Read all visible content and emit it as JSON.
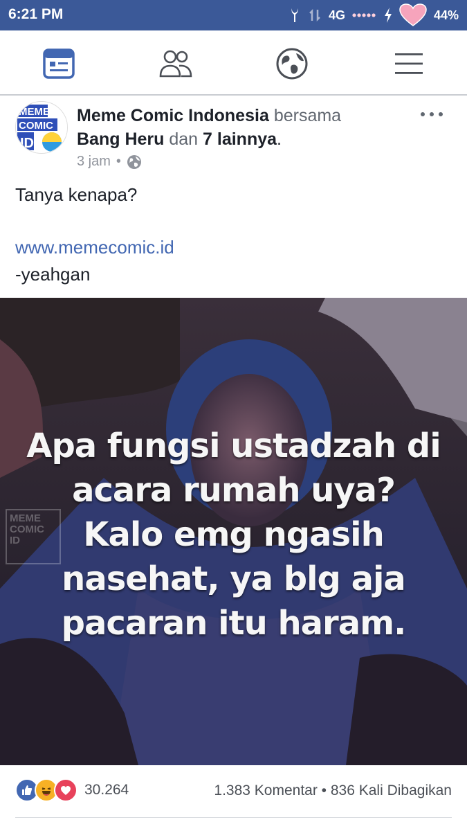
{
  "status_bar": {
    "time": "6:21 PM",
    "network": "4G",
    "battery": "44%"
  },
  "nav": {
    "tabs": [
      {
        "name": "news-feed-icon",
        "active": true
      },
      {
        "name": "friends-icon",
        "active": false
      },
      {
        "name": "notifications-globe-icon",
        "active": false
      },
      {
        "name": "menu-icon",
        "active": false
      }
    ],
    "accent_color": "#4267b2"
  },
  "post": {
    "page_name": "Meme Comic Indonesia",
    "with_word": "bersama",
    "tagged_person": "Bang Heru",
    "and_word": "dan",
    "others": "7 lainnya",
    "period": ".",
    "time": "3 jam",
    "separator": "•",
    "privacy_icon": "globe-icon",
    "avatar_text": [
      "MEME",
      "COMIC",
      "ID"
    ],
    "text": "Tanya kenapa?",
    "link": "www.memecomic.id",
    "signature": "-yeahgan",
    "image": {
      "caption_lines": [
        "Apa fungsi ustadzah di",
        "acara rumah uya?",
        "Kalo emg ngasih",
        "nasehat, ya blg aja",
        "pacaran itu haram."
      ],
      "watermark": [
        "MEME",
        "COMIC",
        "ID"
      ]
    },
    "reactions": {
      "icons": [
        "like-icon",
        "haha-icon",
        "love-icon"
      ],
      "count": "30.264",
      "comments": "1.383 Komentar",
      "dot": "•",
      "shares": "836 Kali Dibagikan"
    }
  }
}
